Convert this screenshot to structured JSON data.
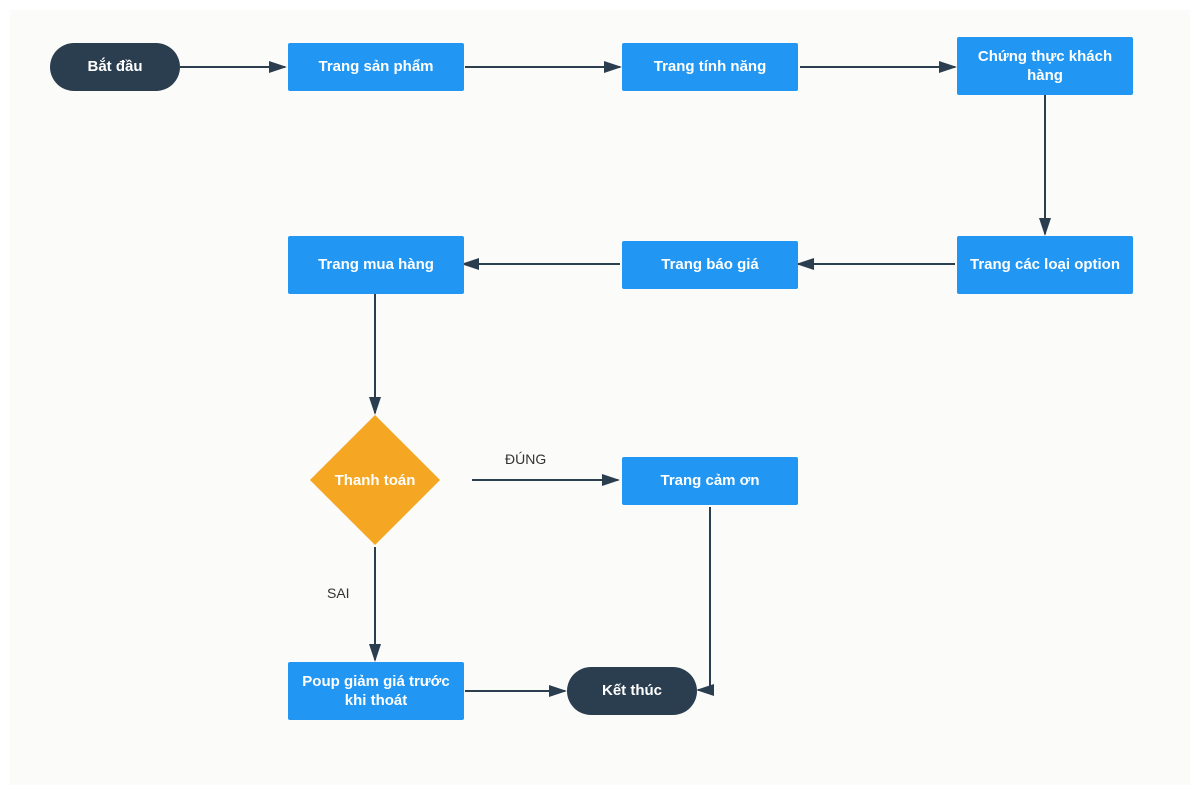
{
  "nodes": {
    "start": "Bắt đầu",
    "product_page": "Trang sản phẩm",
    "feature_page": "Trang tính năng",
    "customer_auth": "Chứng thực khách hàng",
    "options_page": "Trang các loại option",
    "pricing_page": "Trang báo giá",
    "purchase_page": "Trang mua hàng",
    "payment": "Thanh toán",
    "thankyou_page": "Trang cảm ơn",
    "exit_popup": "Poup giảm giá trước khi thoát",
    "end": "Kết thúc"
  },
  "edge_labels": {
    "true": "ĐÚNG",
    "false": "SAI"
  },
  "colors": {
    "terminator": "#2b3e50",
    "process": "#2196f3",
    "decision": "#f5a623",
    "arrow": "#2b3e50",
    "canvas": "#fbfbfa"
  }
}
